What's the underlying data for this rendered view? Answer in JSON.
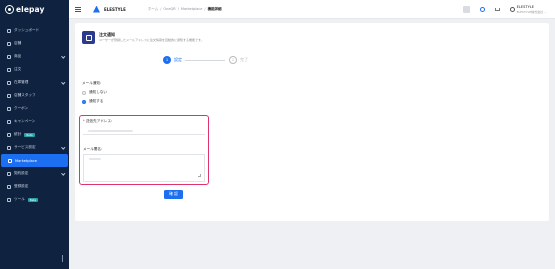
{
  "brand": {
    "logo_text": "elepay"
  },
  "sidebar": {
    "items": [
      {
        "label": "ダッシュボード",
        "icon": "dashboard-icon",
        "chevron": false
      },
      {
        "label": "店舗",
        "icon": "store-icon",
        "chevron": false
      },
      {
        "label": "商品",
        "icon": "product-icon",
        "chevron": true
      },
      {
        "label": "注文",
        "icon": "order-icon",
        "chevron": false
      },
      {
        "label": "在庫管理",
        "icon": "inventory-icon",
        "chevron": true
      },
      {
        "label": "店舗スタッフ",
        "icon": "staff-icon",
        "chevron": false
      },
      {
        "label": "クーポン",
        "icon": "coupon-icon",
        "chevron": false
      },
      {
        "label": "キャンペーン",
        "icon": "campaign-icon",
        "chevron": false
      },
      {
        "label": "統計",
        "icon": "stats-icon",
        "chevron": false,
        "badge": "Beta"
      },
      {
        "label": "サービス設定",
        "icon": "service-settings-icon",
        "chevron": true
      },
      {
        "label": "Marketplace",
        "icon": "marketplace-icon",
        "chevron": false,
        "active": true
      },
      {
        "label": "契約設定",
        "icon": "contract-icon",
        "chevron": true
      },
      {
        "label": "登録設定",
        "icon": "registration-icon",
        "chevron": false
      },
      {
        "label": "ツール",
        "icon": "tool-icon",
        "chevron": false,
        "badge": "Beta"
      }
    ]
  },
  "header": {
    "store_name": "ELESTYLE",
    "breadcrumb": [
      "ホーム",
      "OneQR",
      "Marketplace",
      "機能詳細"
    ],
    "user_name": "ELESTYLE",
    "user_sub": "ELESTYLE株式会社 ..."
  },
  "card": {
    "title": "注文通知",
    "description": "ユーザーが登録したメールアドレスに注文情報を自動的に通知する機能です。",
    "steps": [
      {
        "num": "1",
        "label": "設定"
      },
      {
        "num": "2",
        "label": "完了"
      }
    ],
    "mail_notify_label": "メール通知:",
    "options": [
      "通知しない",
      "通知する"
    ],
    "selected_option": "通知する",
    "address_label": "送信先アドレス:",
    "address_required_mark": "*",
    "subject_label": "メール署名:",
    "confirm_label": "確 認"
  },
  "colors": {
    "accent": "#1d6ff2",
    "sidebar": "#0f2240",
    "highlight": "#e0336d"
  }
}
